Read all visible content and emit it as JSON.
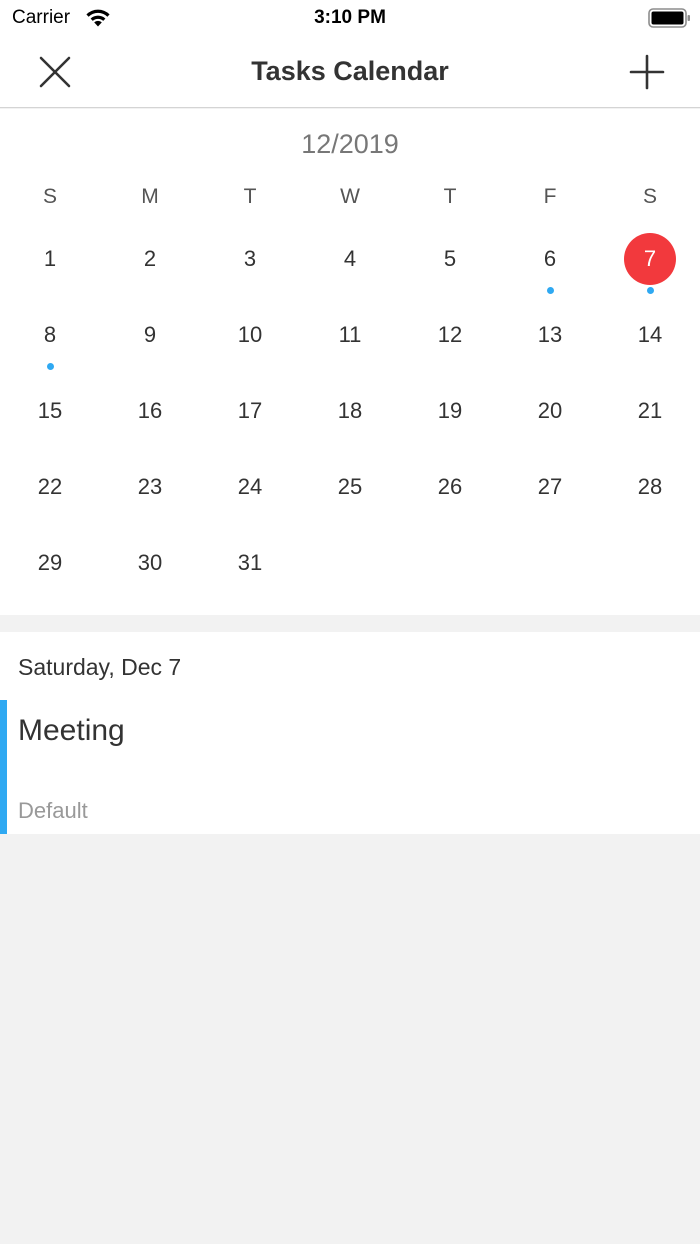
{
  "status_bar": {
    "carrier": "Carrier",
    "time": "3:10 PM",
    "wifi_icon": "wifi-icon",
    "battery_icon": "battery-icon"
  },
  "nav": {
    "title": "Tasks Calendar",
    "close_icon": "close-icon",
    "add_icon": "plus-icon"
  },
  "calendar": {
    "month_label": "12/2019",
    "weekdays": [
      "S",
      "M",
      "T",
      "W",
      "T",
      "F",
      "S"
    ],
    "leading_blank_days": 0,
    "days_in_month": 31,
    "selected_day": 7,
    "days_with_tasks": [
      6,
      7,
      8
    ],
    "selected_color": "#f2393d",
    "task_dot_color": "#2fa9f2"
  },
  "tasks": {
    "selected_date_label": "Saturday, Dec 7",
    "items": [
      {
        "title": "Meeting",
        "category": "Default",
        "color": "#2fa9f2"
      }
    ]
  }
}
